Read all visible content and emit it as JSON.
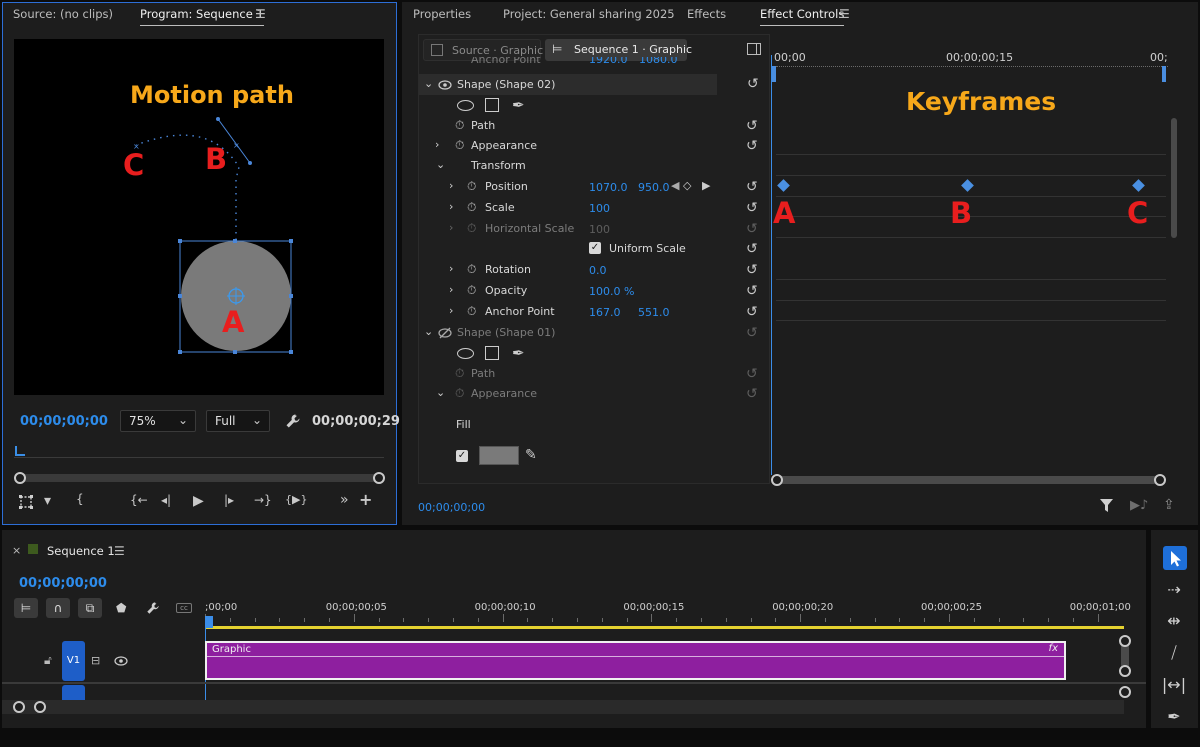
{
  "program_monitor": {
    "tab_source": "Source: (no clips)",
    "tab_program": "Program: Sequence 1",
    "menu_glyph": "☰",
    "annotation_motion_path": "Motion path",
    "label_a": "A",
    "label_b": "B",
    "label_c": "C",
    "timecode_current": "00;00;00;00",
    "timecode_duration": "00;00;00;29",
    "zoom_value": "75%",
    "resolution_value": "Full",
    "transport": {
      "marker": "▾",
      "in": "{",
      "out": "}",
      "go_in": "{←",
      "step_back": "◂|",
      "play": "▶",
      "step_fwd": "|▸",
      "go_out": "→}",
      "play_in_out": "{▶}",
      "more": "»",
      "add": "+"
    }
  },
  "effect_controls": {
    "tabs": [
      "Properties",
      "Project: General sharing 2025",
      "Effects",
      "Effect Controls"
    ],
    "source_chip": "Source · Graphic",
    "sequence_chip": "Sequence 1 · Graphic",
    "top_cut_row": {
      "label": "Anchor Point",
      "v1": "1920.0",
      "v2": "1080.0"
    },
    "shape02": "Shape (Shape 02)",
    "path": "Path",
    "appearance": "Appearance",
    "transform": "Transform",
    "position": {
      "label": "Position",
      "x": "1070.0",
      "y": "950.0"
    },
    "scale": {
      "label": "Scale",
      "value": "100"
    },
    "hscale": {
      "label": "Horizontal Scale",
      "value": "100"
    },
    "uniform": "Uniform Scale",
    "rotation": {
      "label": "Rotation",
      "value": "0.0"
    },
    "opacity": {
      "label": "Opacity",
      "value": "100.0 %"
    },
    "anchor": {
      "label": "Anchor Point",
      "x": "167.0",
      "y": "551.0"
    },
    "shape01": "Shape (Shape 01)",
    "path2": "Path",
    "appearance2": "Appearance",
    "fill": "Fill",
    "timecode": "00;00;00;00",
    "ruler": {
      "t0": "00;00",
      "t15": "00;00;00;15",
      "tend": "00;"
    },
    "annotation_keyframes": "Keyframes",
    "keyframe_labels": [
      "A",
      "B",
      "C"
    ],
    "keyframe_frames": [
      0,
      15,
      29
    ]
  },
  "timeline": {
    "close": "×",
    "title": "Sequence 1",
    "menu_glyph": "☰",
    "timecode": "00;00;00;00",
    "ruler_labels": [
      ";00;00",
      "00;00;00;05",
      "00;00;00;10",
      "00;00;00;15",
      "00;00;00;20",
      "00;00;00;25",
      "00;00;01;00"
    ],
    "track_v1": "V1",
    "clip_name": "Graphic",
    "clip_fx": "fx"
  },
  "colors": {
    "accent_blue": "#2d8ceb",
    "clip_purple": "#8e1f9f",
    "annotation_orange": "#f7a81a",
    "annotation_red": "#e81e1e"
  }
}
